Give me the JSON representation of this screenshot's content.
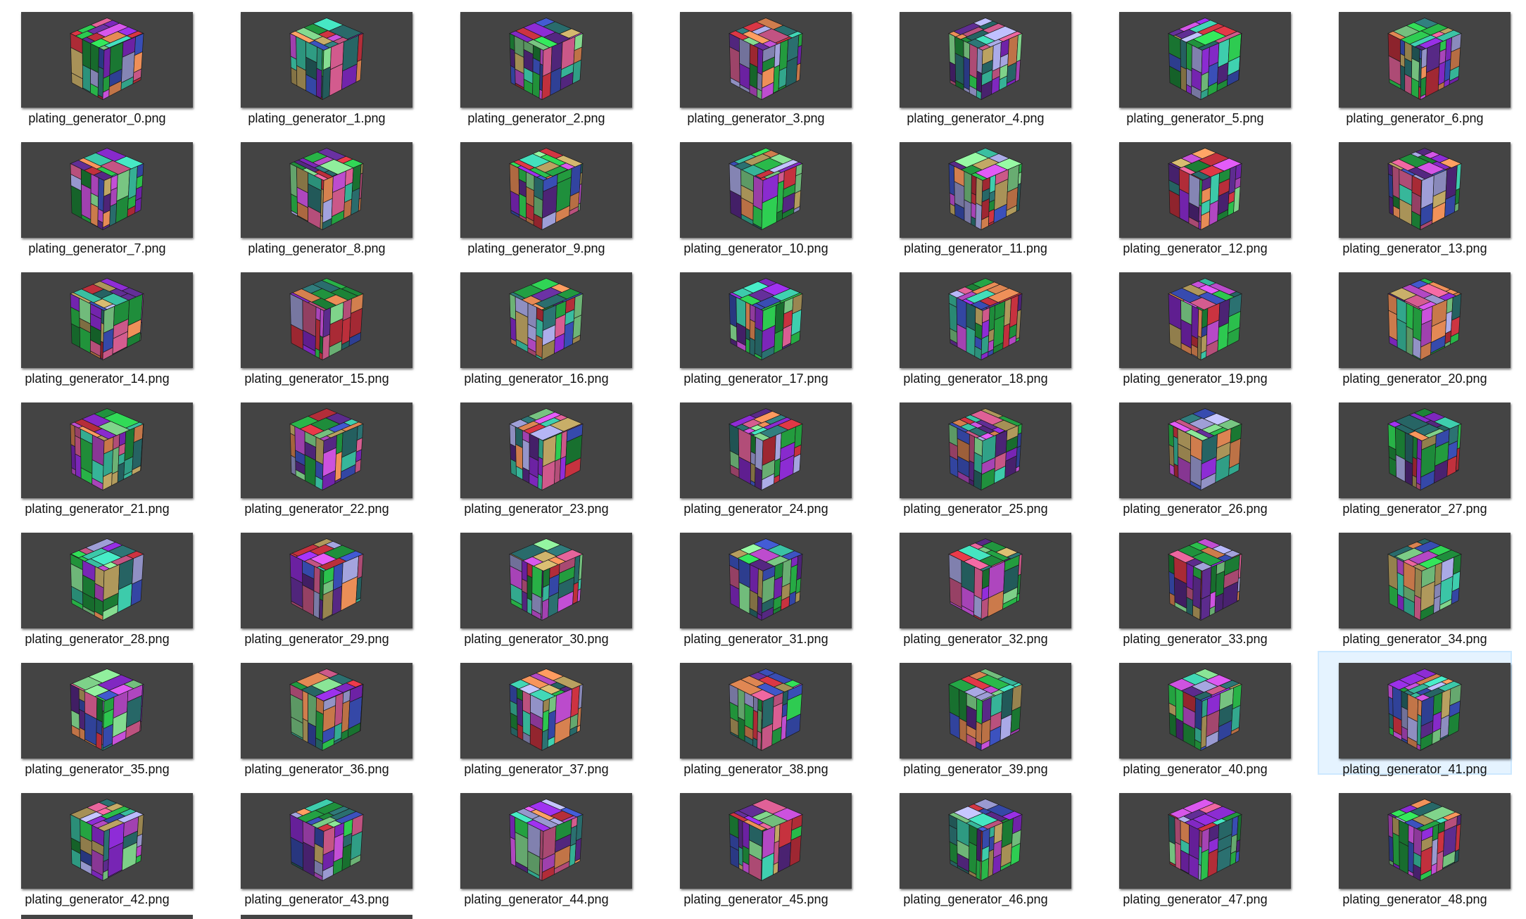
{
  "view": {
    "selected_index": 41,
    "thumbnail_background": "#444444",
    "selection_color": "#e5f3ff"
  },
  "palette": [
    "#1e8a3a",
    "#2cc44e",
    "#8a2bd0",
    "#c8323f",
    "#e58a55",
    "#3cc7a8",
    "#3a4fb8",
    "#c44fd6",
    "#a5a5e0",
    "#7fd28a",
    "#d05a8c",
    "#2a6e6e",
    "#b8a060",
    "#5a2a8a"
  ],
  "files": [
    {
      "name": "plating_generator_0.png"
    },
    {
      "name": "plating_generator_1.png"
    },
    {
      "name": "plating_generator_2.png"
    },
    {
      "name": "plating_generator_3.png"
    },
    {
      "name": "plating_generator_4.png"
    },
    {
      "name": "plating_generator_5.png"
    },
    {
      "name": "plating_generator_6.png"
    },
    {
      "name": "plating_generator_7.png"
    },
    {
      "name": "plating_generator_8.png"
    },
    {
      "name": "plating_generator_9.png"
    },
    {
      "name": "plating_generator_10.png"
    },
    {
      "name": "plating_generator_11.png"
    },
    {
      "name": "plating_generator_12.png"
    },
    {
      "name": "plating_generator_13.png"
    },
    {
      "name": "plating_generator_14.png"
    },
    {
      "name": "plating_generator_15.png"
    },
    {
      "name": "plating_generator_16.png"
    },
    {
      "name": "plating_generator_17.png"
    },
    {
      "name": "plating_generator_18.png"
    },
    {
      "name": "plating_generator_19.png"
    },
    {
      "name": "plating_generator_20.png"
    },
    {
      "name": "plating_generator_21.png"
    },
    {
      "name": "plating_generator_22.png"
    },
    {
      "name": "plating_generator_23.png"
    },
    {
      "name": "plating_generator_24.png"
    },
    {
      "name": "plating_generator_25.png"
    },
    {
      "name": "plating_generator_26.png"
    },
    {
      "name": "plating_generator_27.png"
    },
    {
      "name": "plating_generator_28.png"
    },
    {
      "name": "plating_generator_29.png"
    },
    {
      "name": "plating_generator_30.png"
    },
    {
      "name": "plating_generator_31.png"
    },
    {
      "name": "plating_generator_32.png"
    },
    {
      "name": "plating_generator_33.png"
    },
    {
      "name": "plating_generator_34.png"
    },
    {
      "name": "plating_generator_35.png"
    },
    {
      "name": "plating_generator_36.png"
    },
    {
      "name": "plating_generator_37.png"
    },
    {
      "name": "plating_generator_38.png"
    },
    {
      "name": "plating_generator_39.png"
    },
    {
      "name": "plating_generator_40.png"
    },
    {
      "name": "plating_generator_41.png"
    },
    {
      "name": "plating_generator_42.png"
    },
    {
      "name": "plating_generator_43.png"
    },
    {
      "name": "plating_generator_44.png"
    },
    {
      "name": "plating_generator_45.png"
    },
    {
      "name": "plating_generator_46.png"
    },
    {
      "name": "plating_generator_47.png"
    },
    {
      "name": "plating_generator_48.png"
    }
  ]
}
